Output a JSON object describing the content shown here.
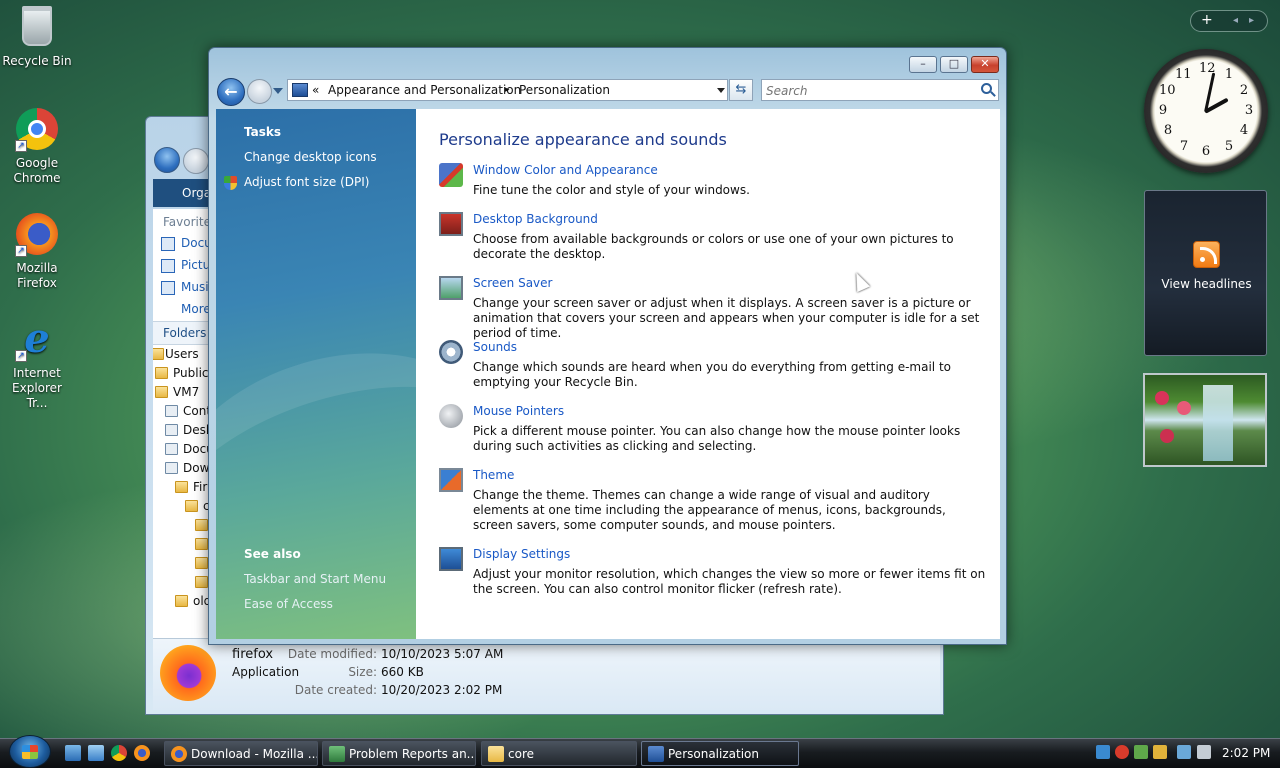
{
  "desktop": {
    "icons": [
      {
        "label": "Recycle Bin"
      },
      {
        "label": "Google Chrome"
      },
      {
        "label": "Mozilla Firefox"
      },
      {
        "label": "Internet Explorer Tr..."
      }
    ]
  },
  "explorer_back": {
    "toolbar_label": "Orga",
    "favorites_header": "Favorite",
    "favorites": [
      "Docu",
      "Pictu",
      "Musi",
      "More"
    ],
    "folders_header": "Folders",
    "tree": [
      "Users",
      "Public",
      "VM7",
      "Cont",
      "Desk",
      "Docu",
      "Dow",
      "Fir",
      "c",
      "",
      "",
      "",
      "",
      "old"
    ],
    "details": {
      "name": "firefox",
      "type": "Application",
      "modified_label": "Date modified:",
      "modified_value": "10/10/2023 5:07 AM",
      "size_label": "Size:",
      "size_value": "660 KB",
      "created_label": "Date created:",
      "created_value": "10/20/2023 2:02 PM"
    }
  },
  "window": {
    "title_buttons": {
      "minimize": "–",
      "maximize": "□",
      "close": "✕"
    },
    "address": {
      "prefix": "«",
      "crumb1": "Appearance and Personalization",
      "sep": "▸",
      "crumb2": "Personalization"
    },
    "search_placeholder": "Search",
    "tasks": {
      "header": "Tasks",
      "links": [
        "Change desktop icons",
        "Adjust font size (DPI)"
      ],
      "see_also_header": "See also",
      "see_also": [
        "Taskbar and Start Menu",
        "Ease of Access"
      ]
    },
    "heading": "Personalize appearance and sounds",
    "items": [
      {
        "title": "Window Color and Appearance",
        "desc": "Fine tune the color and style of your windows.",
        "icon": "window-color-icon"
      },
      {
        "title": "Desktop Background",
        "desc": "Choose from available backgrounds or colors or use one of your own pictures to decorate the desktop.",
        "icon": "desktop-background-icon"
      },
      {
        "title": "Screen Saver",
        "desc": "Change your screen saver or adjust when it displays. A screen saver is a picture or animation that covers your screen and appears when your computer is idle for a set period of time.",
        "icon": "screen-saver-icon"
      },
      {
        "title": "Sounds",
        "desc": "Change which sounds are heard when you do everything from getting e-mail to emptying your Recycle Bin.",
        "icon": "sounds-icon"
      },
      {
        "title": "Mouse Pointers",
        "desc": "Pick a different mouse pointer. You can also change how the mouse pointer looks during such activities as clicking and selecting.",
        "icon": "mouse-pointer-icon"
      },
      {
        "title": "Theme",
        "desc": "Change the theme. Themes can change a wide range of visual and auditory elements at one time including the appearance of menus, icons, backgrounds, screen savers, some computer sounds, and mouse pointers.",
        "icon": "theme-icon"
      },
      {
        "title": "Display Settings",
        "desc": "Adjust your monitor resolution, which changes the view so more or fewer items fit on the screen. You can also control monitor flicker (refresh rate).",
        "icon": "display-settings-icon"
      }
    ]
  },
  "gadgets": {
    "feed_label": "View headlines",
    "clock_numbers": [
      "12",
      "1",
      "2",
      "3",
      "4",
      "5",
      "6",
      "7",
      "8",
      "9",
      "10",
      "11"
    ]
  },
  "taskbar": {
    "buttons": [
      {
        "label": "Download - Mozilla ..."
      },
      {
        "label": "Problem Reports an..."
      },
      {
        "label": "core"
      },
      {
        "label": "Personalization"
      }
    ],
    "time": "2:02 PM"
  },
  "colors": {
    "link": "#1a59c6",
    "heading": "#1e3b8c",
    "taskbar": "#181c20"
  }
}
